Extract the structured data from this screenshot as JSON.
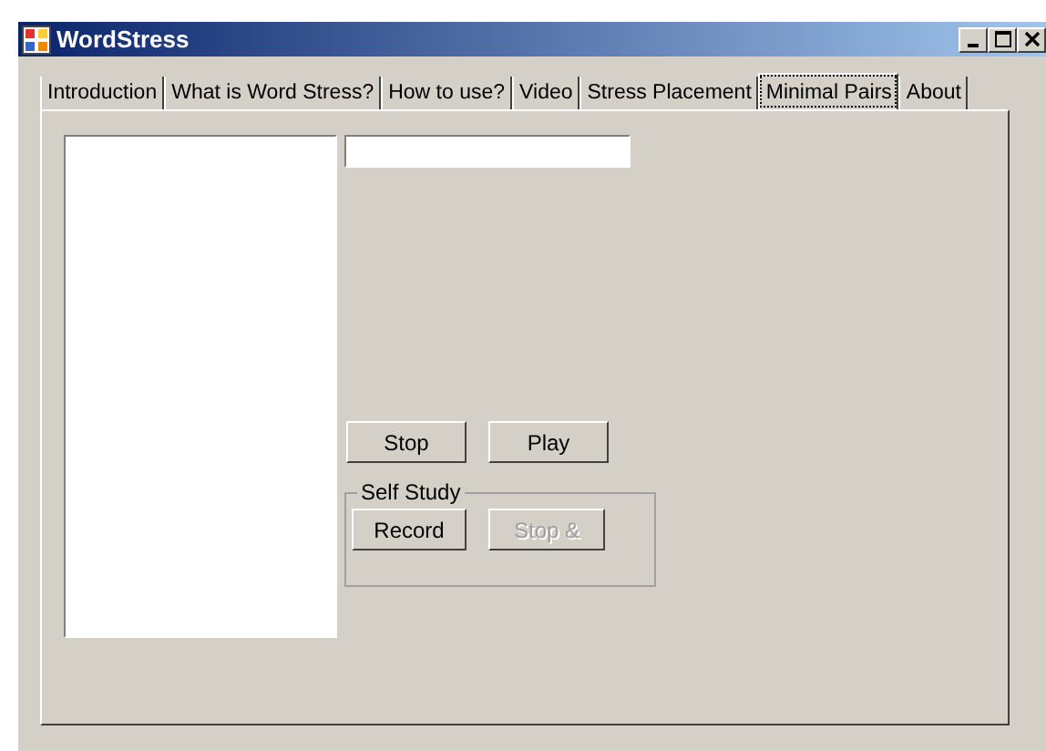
{
  "window": {
    "title": "WordStress"
  },
  "tabs": [
    {
      "label": "Introduction",
      "selected": false
    },
    {
      "label": "What is Word Stress?",
      "selected": false
    },
    {
      "label": "How to use?",
      "selected": false
    },
    {
      "label": "Video",
      "selected": false
    },
    {
      "label": "Stress Placement",
      "selected": false
    },
    {
      "label": "Minimal Pairs",
      "selected": true
    },
    {
      "label": "About",
      "selected": false
    }
  ],
  "playback_buttons": [
    {
      "label": "Stop",
      "disabled": false
    },
    {
      "label": "Play",
      "disabled": false
    }
  ],
  "self_study": {
    "title": "Self Study",
    "buttons": [
      {
        "label": "Record",
        "disabled": false
      },
      {
        "label": "Stop &",
        "disabled": true
      }
    ]
  }
}
